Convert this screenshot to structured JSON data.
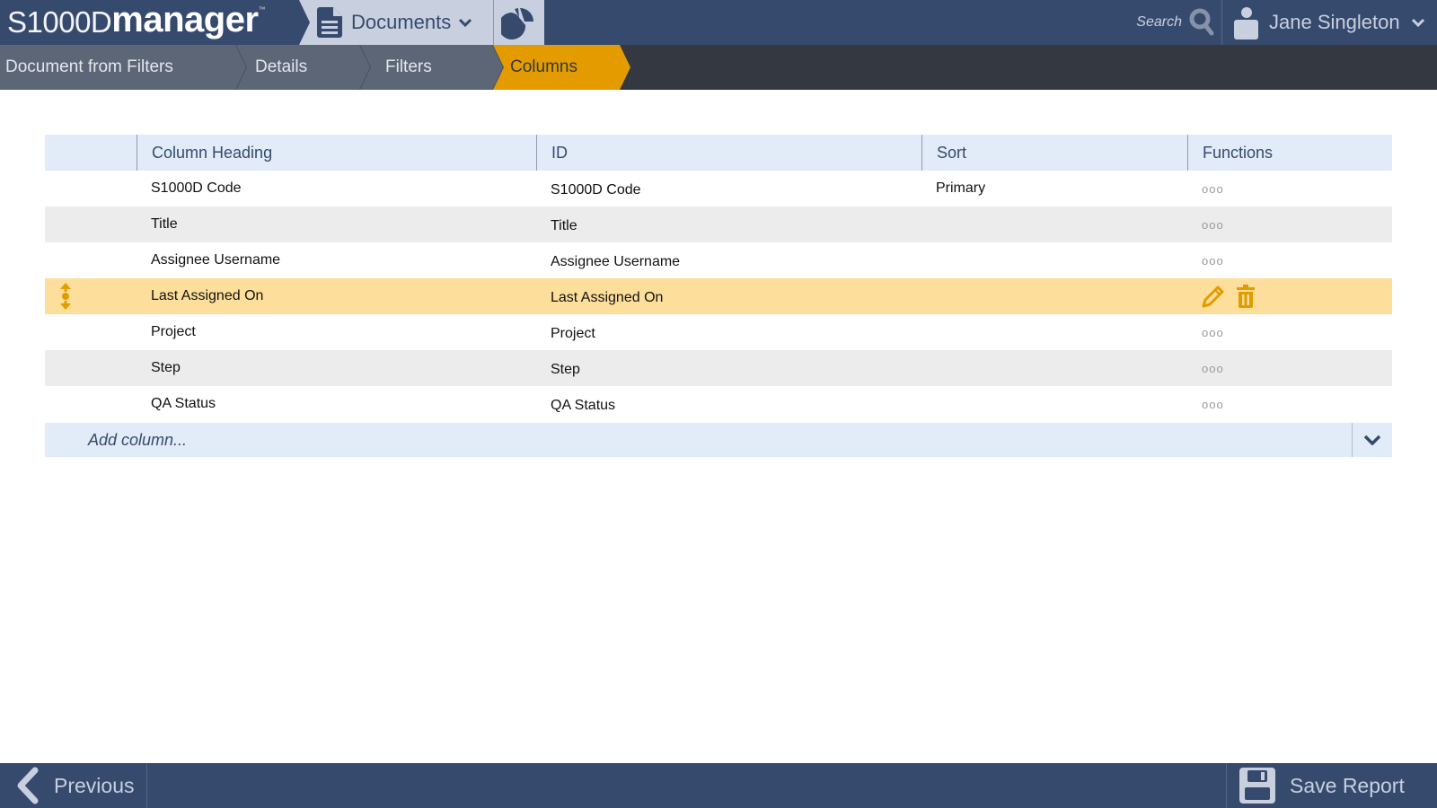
{
  "header": {
    "logo_prefix": "S1000D",
    "logo_main": "manager",
    "logo_tm": "™",
    "documents_label": "Documents",
    "search_label": "Search",
    "user_name": "Jane Singleton"
  },
  "breadcrumbs": [
    {
      "label": "Document from Filters",
      "active": false
    },
    {
      "label": "Details",
      "active": false
    },
    {
      "label": "Filters",
      "active": false
    },
    {
      "label": "Columns",
      "active": true
    }
  ],
  "table": {
    "headers": [
      "",
      "Column Heading",
      "ID",
      "Sort",
      "Functions"
    ],
    "rows": [
      {
        "heading": "S1000D Code",
        "id": "S1000D Code",
        "sort": "Primary",
        "functions": "ooo",
        "selected": false
      },
      {
        "heading": "Title",
        "id": "Title",
        "sort": "",
        "functions": "ooo",
        "selected": false
      },
      {
        "heading": "Assignee Username",
        "id": "Assignee Username",
        "sort": "",
        "functions": "ooo",
        "selected": false
      },
      {
        "heading": "Last Assigned On",
        "id": "Last Assigned On",
        "sort": "",
        "functions": "",
        "selected": true
      },
      {
        "heading": "Project",
        "id": "Project",
        "sort": "",
        "functions": "ooo",
        "selected": false
      },
      {
        "heading": "Step",
        "id": "Step",
        "sort": "",
        "functions": "ooo",
        "selected": false
      },
      {
        "heading": "QA Status",
        "id": "QA Status",
        "sort": "",
        "functions": "ooo",
        "selected": false
      }
    ],
    "add_placeholder": "Add column..."
  },
  "footer": {
    "previous_label": "Previous",
    "save_label": "Save Report"
  },
  "colors": {
    "navy": "#364a6e",
    "accent": "#e39b00",
    "selected_row": "#fddf9b",
    "header_row": "#e2ecf8"
  }
}
